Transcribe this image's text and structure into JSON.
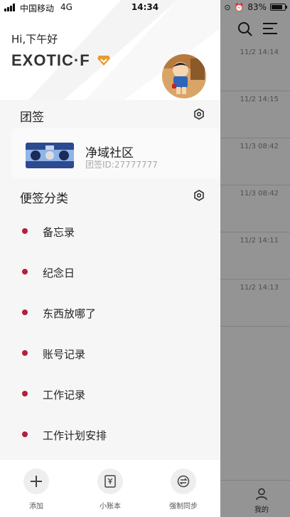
{
  "status_bar": {
    "carrier": "中国移动",
    "network": "4G",
    "time": "14:34",
    "battery": "83%",
    "battery_level": 0.83
  },
  "background_list": {
    "timestamps": [
      "11/2 14:14",
      "11/2 14:15",
      "11/3 08:42",
      "11/3 08:42",
      "11/2 14:11",
      "11/2 14:13"
    ],
    "tab_mine_label": "我的"
  },
  "drawer": {
    "greeting": "Hi,下午好",
    "username": "EXOTIC·F",
    "team_section_title": "团签",
    "team": {
      "name": "净域社区",
      "id": "团签ID:27777777"
    },
    "category_section_title": "便签分类",
    "categories": [
      {
        "label": "备忘录"
      },
      {
        "label": "纪念日"
      },
      {
        "label": "东西放哪了"
      },
      {
        "label": "账号记录"
      },
      {
        "label": "工作记录"
      },
      {
        "label": "工作计划安排"
      }
    ],
    "bottom_actions": [
      {
        "label": "添加",
        "icon": "plus-icon"
      },
      {
        "label": "小账本",
        "icon": "ledger-icon"
      },
      {
        "label": "强制同步",
        "icon": "sync-icon"
      }
    ]
  },
  "colors": {
    "accent": "#e89a2c",
    "category_dot": "#b3203a",
    "scrim": "rgba(0,0,0,0.42)"
  }
}
